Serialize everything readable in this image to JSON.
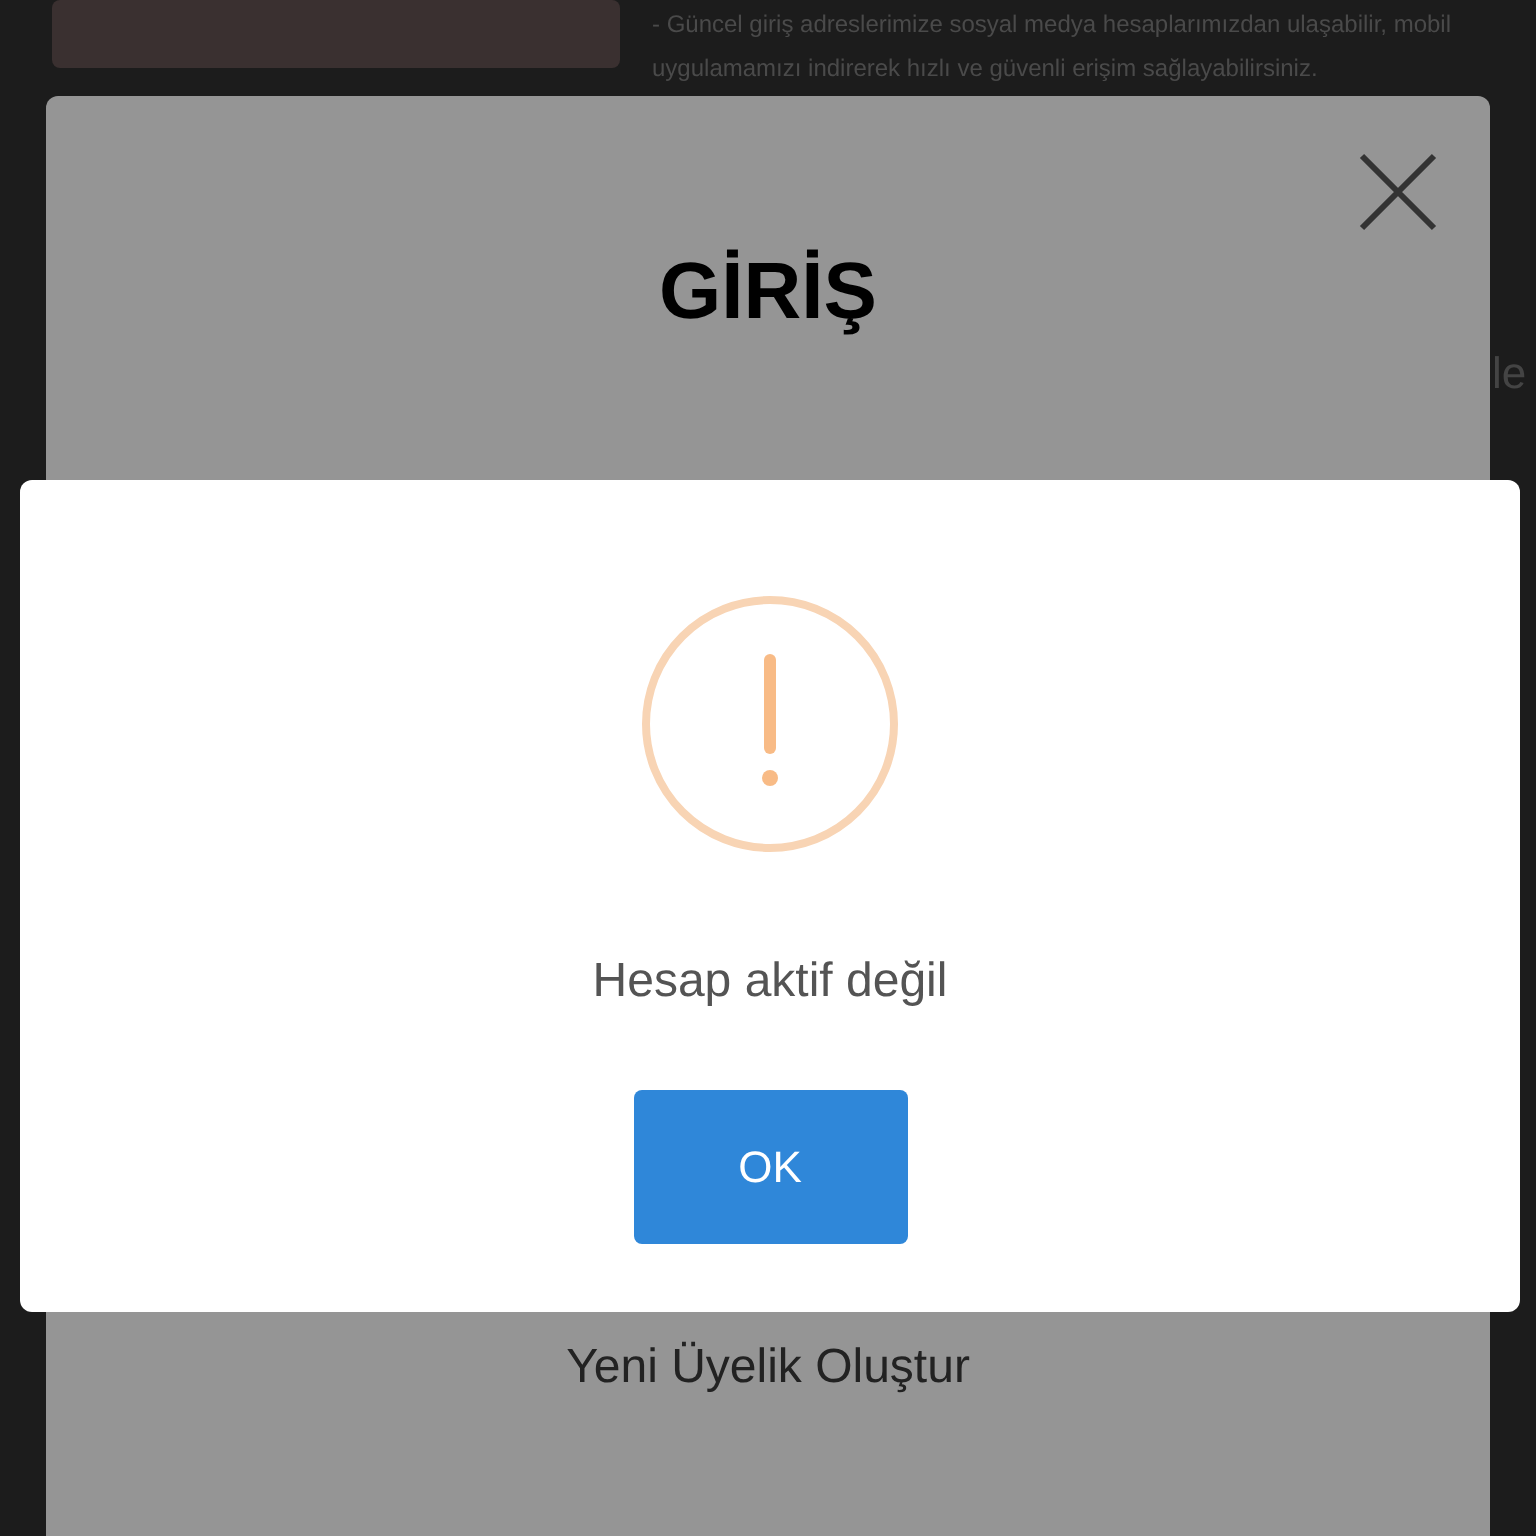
{
  "background": {
    "notice": "- Güncel giriş adreslerimize sosyal medya hesaplarımızdan ulaşabilir, mobil uygulamamızı indirerek hızlı ve güvenli erişim sağlayabilirsiniz.",
    "edge_text": "le"
  },
  "login_modal": {
    "title": "GİRİŞ",
    "register_link": "Yeni Üyelik Oluştur"
  },
  "alert": {
    "kind": "warning",
    "message": "Hesap aktif değil",
    "button": "OK"
  }
}
